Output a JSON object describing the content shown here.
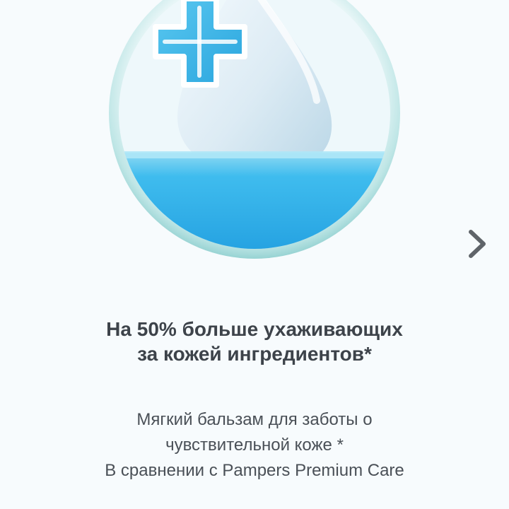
{
  "slide": {
    "image_icon": "water-drop-with-plus-icon",
    "title": "На 50% больше ухаживающих за кожей ингредиентов*",
    "body_line_1": "Мягкий бальзам для заботы о чувствительной коже *",
    "body_line_2": "В сравнении с Pampers Premium Care"
  },
  "navigation": {
    "next_icon": "chevron-right-icon"
  },
  "colors": {
    "background": "#f7fbfd",
    "circle_rim": "#a9dede",
    "drop": "#dcecf4",
    "water": "#36b4ec",
    "plus": "#42b6e8",
    "text": "#3d434a",
    "arrow": "#5f6469"
  }
}
